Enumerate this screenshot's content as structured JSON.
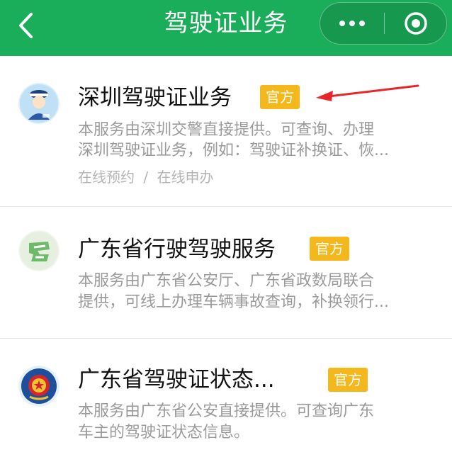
{
  "header": {
    "title": "驾驶证业务",
    "back_icon": "chevron-left-icon",
    "more_icon": "more-dots-icon",
    "close_icon": "target-circle-icon",
    "background_color": "#1aad5a"
  },
  "items": [
    {
      "title": "深圳驾驶证业务",
      "badge": "官方",
      "desc_line1": "本服务由深圳交警直接提供。可查询、办理",
      "desc_line2": "深圳驾驶证业务，例如：驾驶证补换证、恢...",
      "tag1": "在线预约",
      "tag_sep": "/",
      "tag2": "在线申办",
      "avatar_icon": "police-avatar-icon"
    },
    {
      "title": "广东省行驶驾驶服务",
      "badge": "官方",
      "desc_line1": "本服务由广东省公安厅、广东省政数局联合",
      "desc_line2": "提供，可线上办理车辆事故查询，补换领行...",
      "avatar_icon": "map-logo-icon"
    },
    {
      "title": "广东省驾驶证状态...",
      "badge": "官方",
      "desc_line1": "本服务由广东省公安直接提供。可查询广东",
      "desc_line2": "车主的驾驶证状态信息。",
      "avatar_icon": "police-emblem-icon"
    }
  ],
  "colors": {
    "badge": "#f5b81c",
    "annotation_arrow": "#e8262a"
  }
}
